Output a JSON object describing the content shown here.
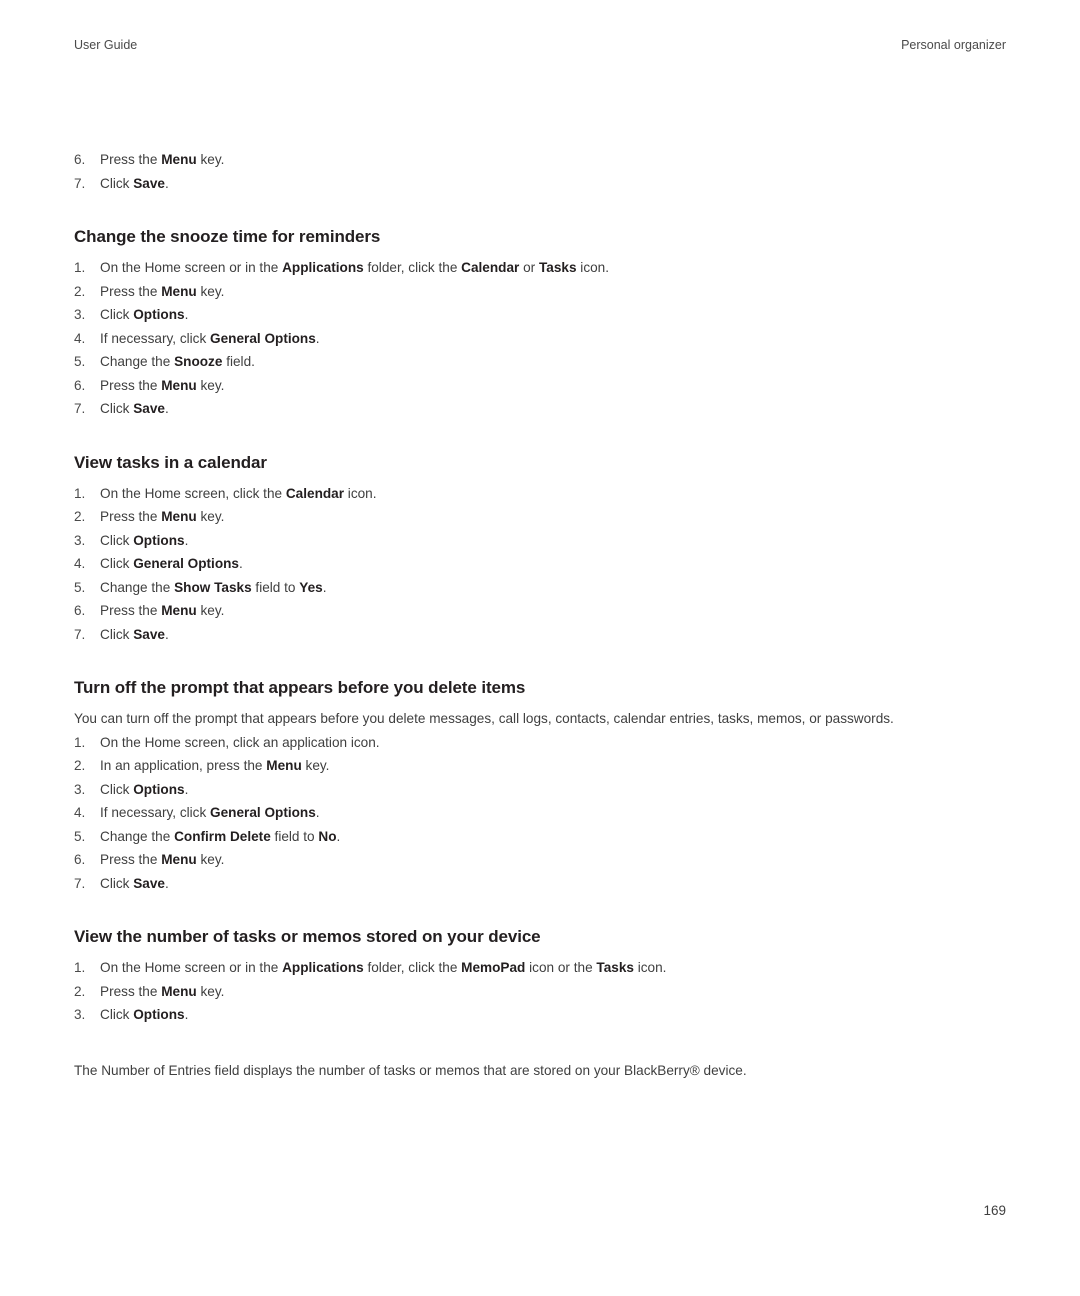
{
  "header": {
    "left": "User Guide",
    "right": "Personal organizer"
  },
  "continued_list": {
    "items": [
      {
        "num": "6.",
        "parts": [
          {
            "t": "Press the ",
            "b": false
          },
          {
            "t": "Menu",
            "b": true
          },
          {
            "t": " key.",
            "b": false
          }
        ]
      },
      {
        "num": "7.",
        "parts": [
          {
            "t": "Click ",
            "b": false
          },
          {
            "t": "Save",
            "b": true
          },
          {
            "t": ".",
            "b": false
          }
        ]
      }
    ]
  },
  "sections": [
    {
      "heading": "Change the snooze time for reminders",
      "intro": null,
      "steps": [
        {
          "num": "1.",
          "parts": [
            {
              "t": "On the Home screen or in the ",
              "b": false
            },
            {
              "t": "Applications",
              "b": true
            },
            {
              "t": " folder, click the ",
              "b": false
            },
            {
              "t": "Calendar",
              "b": true
            },
            {
              "t": " or ",
              "b": false
            },
            {
              "t": "Tasks",
              "b": true
            },
            {
              "t": " icon.",
              "b": false
            }
          ]
        },
        {
          "num": "2.",
          "parts": [
            {
              "t": "Press the ",
              "b": false
            },
            {
              "t": "Menu",
              "b": true
            },
            {
              "t": " key.",
              "b": false
            }
          ]
        },
        {
          "num": "3.",
          "parts": [
            {
              "t": "Click ",
              "b": false
            },
            {
              "t": "Options",
              "b": true
            },
            {
              "t": ".",
              "b": false
            }
          ]
        },
        {
          "num": "4.",
          "parts": [
            {
              "t": "If necessary, click ",
              "b": false
            },
            {
              "t": "General Options",
              "b": true
            },
            {
              "t": ".",
              "b": false
            }
          ]
        },
        {
          "num": "5.",
          "parts": [
            {
              "t": "Change the ",
              "b": false
            },
            {
              "t": "Snooze",
              "b": true
            },
            {
              "t": " field.",
              "b": false
            }
          ]
        },
        {
          "num": "6.",
          "parts": [
            {
              "t": "Press the ",
              "b": false
            },
            {
              "t": "Menu",
              "b": true
            },
            {
              "t": " key.",
              "b": false
            }
          ]
        },
        {
          "num": "7.",
          "parts": [
            {
              "t": "Click ",
              "b": false
            },
            {
              "t": "Save",
              "b": true
            },
            {
              "t": ".",
              "b": false
            }
          ]
        }
      ]
    },
    {
      "heading": "View tasks in a calendar",
      "intro": null,
      "steps": [
        {
          "num": "1.",
          "parts": [
            {
              "t": "On the Home screen, click the ",
              "b": false
            },
            {
              "t": "Calendar",
              "b": true
            },
            {
              "t": " icon.",
              "b": false
            }
          ]
        },
        {
          "num": "2.",
          "parts": [
            {
              "t": "Press the ",
              "b": false
            },
            {
              "t": "Menu",
              "b": true
            },
            {
              "t": " key.",
              "b": false
            }
          ]
        },
        {
          "num": "3.",
          "parts": [
            {
              "t": "Click ",
              "b": false
            },
            {
              "t": "Options",
              "b": true
            },
            {
              "t": ".",
              "b": false
            }
          ]
        },
        {
          "num": "4.",
          "parts": [
            {
              "t": "Click ",
              "b": false
            },
            {
              "t": "General Options",
              "b": true
            },
            {
              "t": ".",
              "b": false
            }
          ]
        },
        {
          "num": "5.",
          "parts": [
            {
              "t": "Change the ",
              "b": false
            },
            {
              "t": "Show Tasks",
              "b": true
            },
            {
              "t": " field to ",
              "b": false
            },
            {
              "t": "Yes",
              "b": true
            },
            {
              "t": ".",
              "b": false
            }
          ]
        },
        {
          "num": "6.",
          "parts": [
            {
              "t": "Press the ",
              "b": false
            },
            {
              "t": "Menu",
              "b": true
            },
            {
              "t": " key.",
              "b": false
            }
          ]
        },
        {
          "num": "7.",
          "parts": [
            {
              "t": "Click ",
              "b": false
            },
            {
              "t": "Save",
              "b": true
            },
            {
              "t": ".",
              "b": false
            }
          ]
        }
      ]
    },
    {
      "heading": "Turn off the prompt that appears before you delete items",
      "intro": "You can turn off the prompt that appears before you delete messages, call logs, contacts, calendar entries, tasks, memos, or passwords.",
      "steps": [
        {
          "num": "1.",
          "parts": [
            {
              "t": "On the Home screen, click an application icon.",
              "b": false
            }
          ]
        },
        {
          "num": "2.",
          "parts": [
            {
              "t": "In an application, press the ",
              "b": false
            },
            {
              "t": "Menu",
              "b": true
            },
            {
              "t": " key.",
              "b": false
            }
          ]
        },
        {
          "num": "3.",
          "parts": [
            {
              "t": "Click ",
              "b": false
            },
            {
              "t": "Options",
              "b": true
            },
            {
              "t": ".",
              "b": false
            }
          ]
        },
        {
          "num": "4.",
          "parts": [
            {
              "t": "If necessary, click ",
              "b": false
            },
            {
              "t": "General Options",
              "b": true
            },
            {
              "t": ".",
              "b": false
            }
          ]
        },
        {
          "num": "5.",
          "parts": [
            {
              "t": "Change the ",
              "b": false
            },
            {
              "t": "Confirm Delete",
              "b": true
            },
            {
              "t": " field to ",
              "b": false
            },
            {
              "t": "No",
              "b": true
            },
            {
              "t": ".",
              "b": false
            }
          ]
        },
        {
          "num": "6.",
          "parts": [
            {
              "t": "Press the ",
              "b": false
            },
            {
              "t": "Menu",
              "b": true
            },
            {
              "t": " key.",
              "b": false
            }
          ]
        },
        {
          "num": "7.",
          "parts": [
            {
              "t": "Click ",
              "b": false
            },
            {
              "t": "Save",
              "b": true
            },
            {
              "t": ".",
              "b": false
            }
          ]
        }
      ]
    },
    {
      "heading": "View the number of tasks or memos stored on your device",
      "intro": null,
      "steps": [
        {
          "num": "1.",
          "parts": [
            {
              "t": "On the Home screen or in the ",
              "b": false
            },
            {
              "t": "Applications",
              "b": true
            },
            {
              "t": " folder, click the ",
              "b": false
            },
            {
              "t": "MemoPad",
              "b": true
            },
            {
              "t": " icon or the ",
              "b": false
            },
            {
              "t": "Tasks",
              "b": true
            },
            {
              "t": " icon.",
              "b": false
            }
          ]
        },
        {
          "num": "2.",
          "parts": [
            {
              "t": "Press the ",
              "b": false
            },
            {
              "t": "Menu",
              "b": true
            },
            {
              "t": " key.",
              "b": false
            }
          ]
        },
        {
          "num": "3.",
          "parts": [
            {
              "t": "Click ",
              "b": false
            },
            {
              "t": "Options",
              "b": true
            },
            {
              "t": ".",
              "b": false
            }
          ]
        }
      ],
      "outro": "The Number of Entries field displays the number of tasks or memos that are stored on your BlackBerry® device."
    }
  ],
  "folio": "169"
}
